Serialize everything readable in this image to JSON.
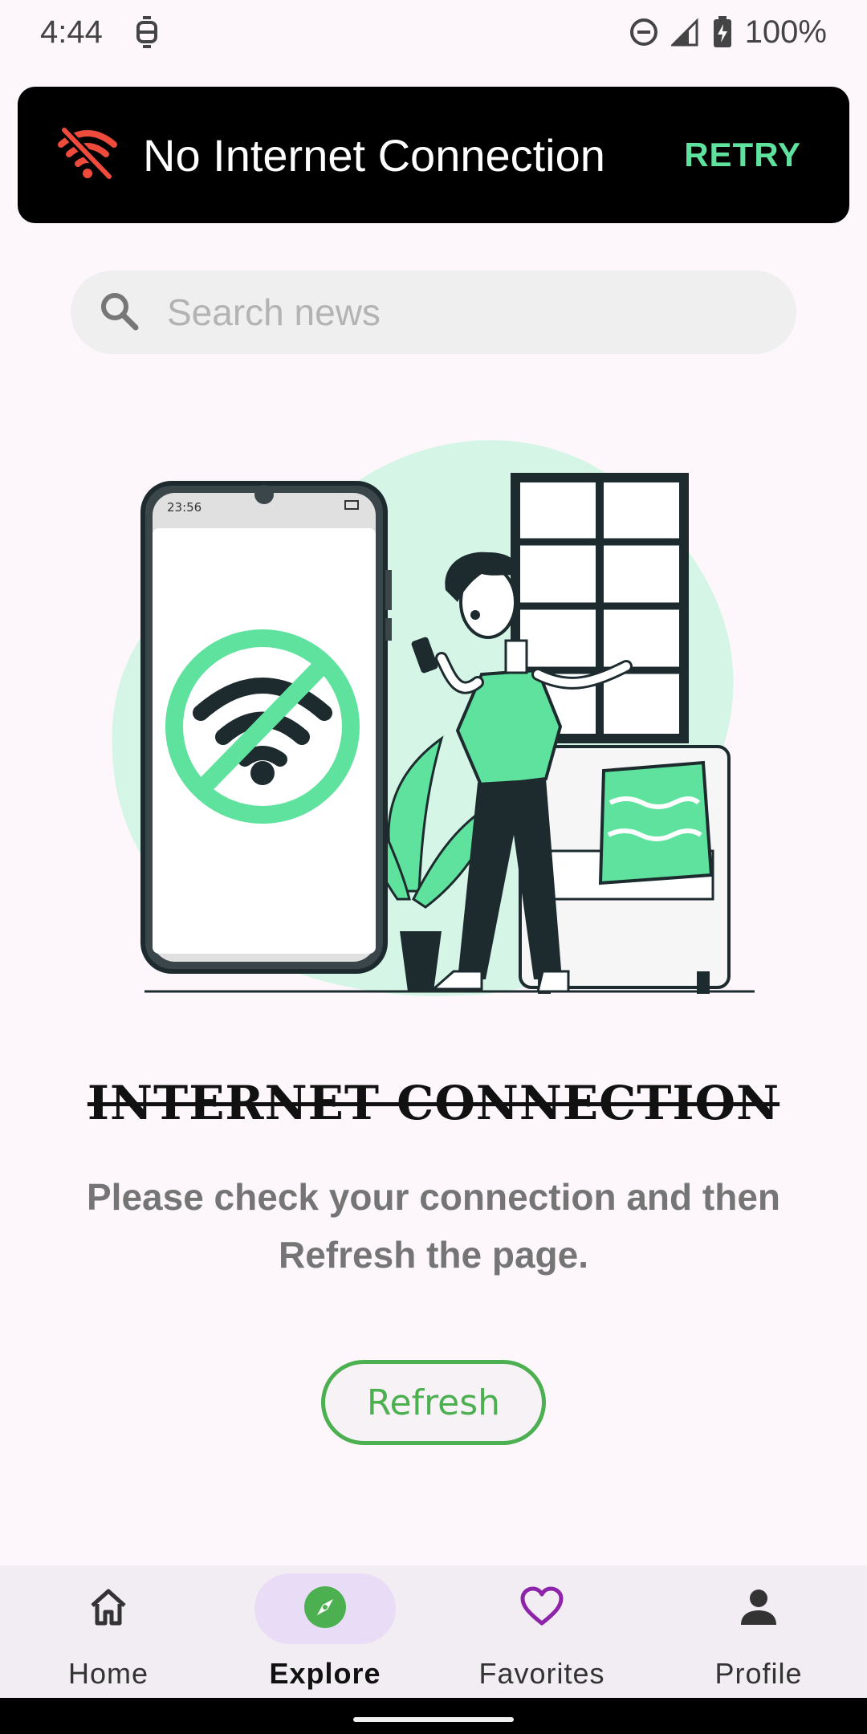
{
  "status_bar": {
    "time": "4:44",
    "battery": "100%",
    "icons": [
      "notification-icon",
      "dnd-icon",
      "signal-icon",
      "battery-charging-icon"
    ]
  },
  "banner": {
    "icon": "wifi-off-icon",
    "text": "No Internet Connection",
    "action": "RETRY"
  },
  "search": {
    "placeholder": "Search news",
    "value": ""
  },
  "illustration": {
    "phone_time": "23:56"
  },
  "content": {
    "heading": "INTERNET CONNECTION",
    "message": "Please check your connection and then Refresh the page.",
    "button": "Refresh"
  },
  "nav": {
    "items": [
      {
        "label": "Home",
        "icon": "home-icon"
      },
      {
        "label": "Explore",
        "icon": "compass-icon",
        "active": true
      },
      {
        "label": "Favorites",
        "icon": "heart-icon"
      },
      {
        "label": "Profile",
        "icon": "person-icon"
      }
    ]
  },
  "colors": {
    "accent_green": "#5ee29e",
    "refresh_green": "#4caf50",
    "wifi_off_red": "#ef4b3c",
    "favorites_purple": "#8e24aa",
    "active_pill": "#e9dcf7"
  }
}
